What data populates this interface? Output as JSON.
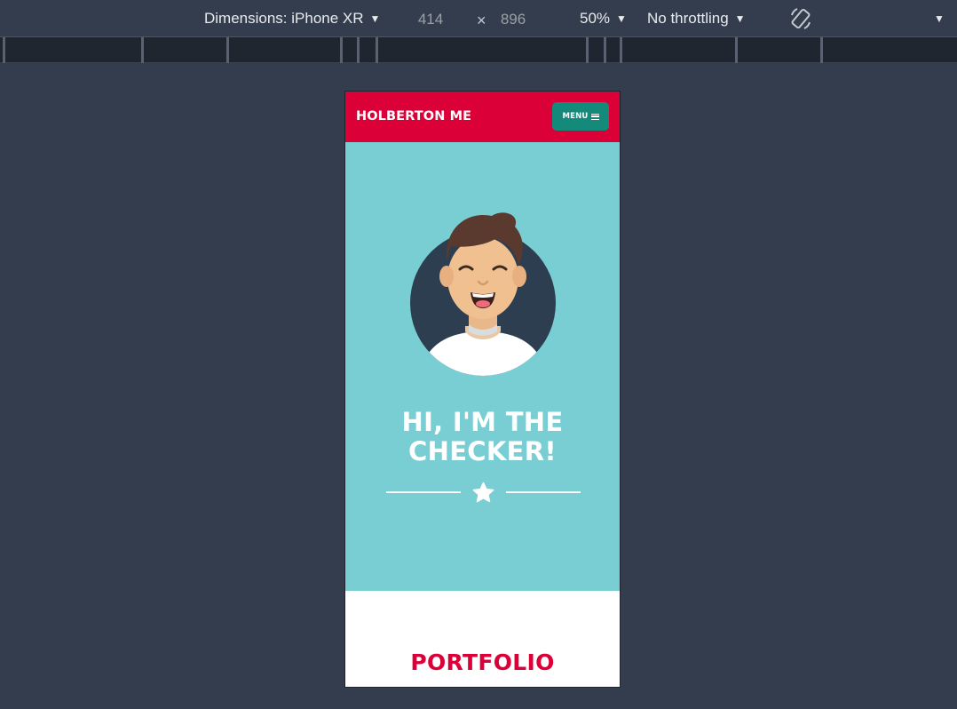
{
  "devtools": {
    "dimensions_label": "Dimensions: iPhone XR",
    "width_value": "414",
    "height_value": "896",
    "times": "×",
    "zoom": "50%",
    "throttling": "No throttling"
  },
  "site": {
    "brand": "HOLBERTON ME",
    "menu_label": "MENU",
    "hero_title_line1": "HI, I'M THE",
    "hero_title_line2": "CHECKER!",
    "portfolio_title": "PORTFOLIO",
    "colors": {
      "navbar": "#dc0038",
      "menu_button": "#148a7a",
      "hero": "#79ced3",
      "portfolio_title": "#dc0038"
    }
  }
}
